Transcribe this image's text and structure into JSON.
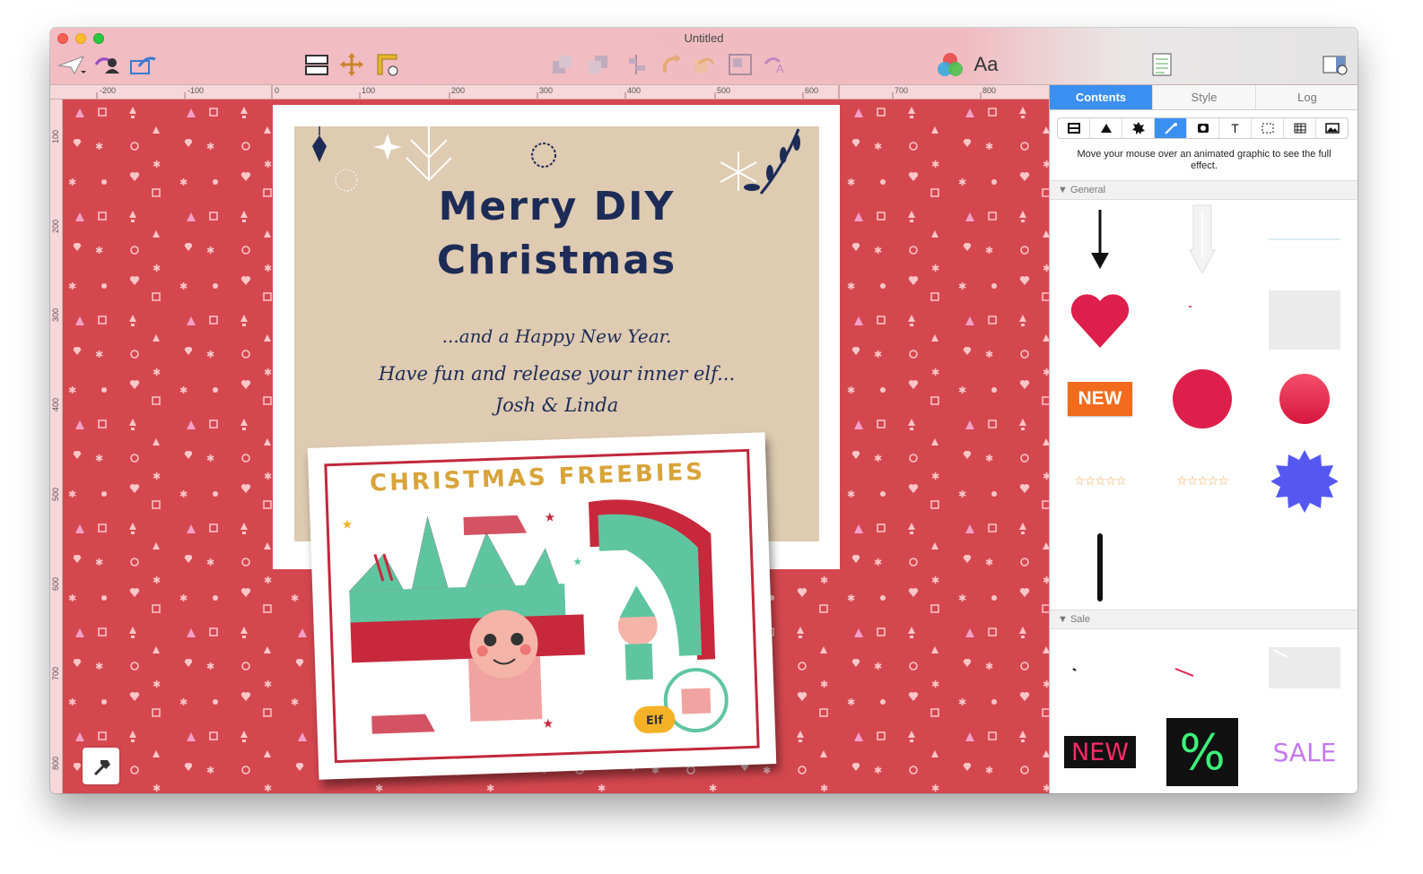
{
  "window": {
    "title": "Untitled"
  },
  "toolbar": {
    "left_icons": [
      "send-icon",
      "share-user-icon",
      "export-icon"
    ],
    "layout_icons": [
      "layout-icon",
      "move-icon",
      "ruler-icon"
    ],
    "arrange_icons": [
      "bring-front-icon",
      "send-back-icon",
      "align-icon",
      "rotate-icon",
      "flip-icon",
      "group-icon",
      "text-path-icon"
    ],
    "colors_icon": "colors-icon",
    "fonts_label": "Aa",
    "checklist_icon": "checklist-icon",
    "inspector_icon": "inspector-toggle-icon"
  },
  "ruler": {
    "h_labels": [
      "-200",
      "-100",
      "0",
      "100",
      "200",
      "300",
      "400",
      "500",
      "600",
      "700",
      "800"
    ],
    "v_labels": [
      "100",
      "200",
      "300",
      "400",
      "500",
      "600",
      "700",
      "800"
    ]
  },
  "card": {
    "title_line1": "Merry DIY",
    "title_line2": "Christmas",
    "line1": "...and a Happy New Year.",
    "line2": "Have fun and release your inner elf...",
    "signature": "Josh & Linda",
    "freebie_title": "CHRISTMAS FREEBIES",
    "elf_badge": "Elf"
  },
  "panel": {
    "tabs": [
      {
        "label": "Contents",
        "active": true
      },
      {
        "label": "Style",
        "active": false
      },
      {
        "label": "Log",
        "active": false
      }
    ],
    "segments": [
      "shape-icon",
      "triangle-icon",
      "burst-icon",
      "animation-icon",
      "image-icon",
      "text-icon",
      "selection-icon",
      "pattern-icon",
      "photo-icon"
    ],
    "segment_text": "T",
    "hint": "Move your mouse over an animated graphic to see the full effect.",
    "general_label": "General",
    "sale_label": "Sale",
    "new_badge": "NEW",
    "neon_new": "NEW",
    "percent": "%",
    "sale_text": "SALE"
  },
  "colors": {
    "accent": "#3a8ff0",
    "canvas_red": "#d5474f",
    "navy": "#1d2b57",
    "beige": "#decbb1"
  }
}
